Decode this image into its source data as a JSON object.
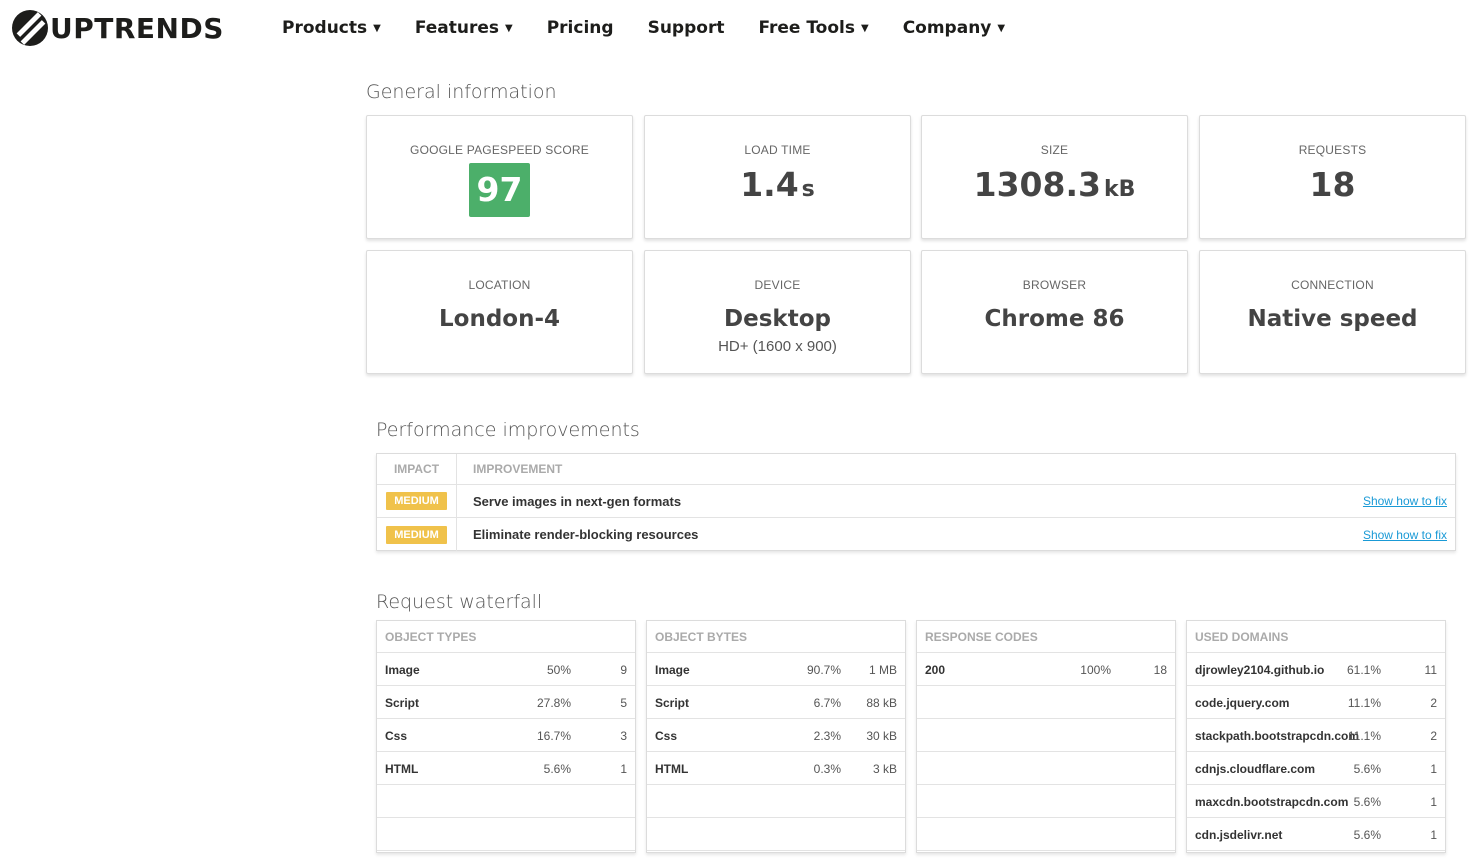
{
  "header": {
    "logo_text": "UPTRENDS",
    "nav": [
      {
        "label": "Products",
        "dropdown": true
      },
      {
        "label": "Features",
        "dropdown": true
      },
      {
        "label": "Pricing",
        "dropdown": false
      },
      {
        "label": "Support",
        "dropdown": false
      },
      {
        "label": "Free Tools",
        "dropdown": true
      },
      {
        "label": "Company",
        "dropdown": true
      }
    ]
  },
  "general": {
    "title": "General information",
    "score_label": "GOOGLE PAGESPEED SCORE",
    "score_value": "97",
    "score_color": "#4caf6a",
    "load_label": "LOAD TIME",
    "load_value": "1.4",
    "load_unit": "s",
    "size_label": "SIZE",
    "size_value": "1308.3",
    "size_unit": "kB",
    "requests_label": "REQUESTS",
    "requests_value": "18",
    "location_label": "LOCATION",
    "location_value": "London-4",
    "device_label": "DEVICE",
    "device_value": "Desktop",
    "device_sub": "HD+ (1600 x 900)",
    "browser_label": "BROWSER",
    "browser_value": "Chrome 86",
    "connection_label": "CONNECTION",
    "connection_value": "Native speed"
  },
  "performance": {
    "title": "Performance improvements",
    "col_impact": "IMPACT",
    "col_improvement": "IMPROVEMENT",
    "rows": [
      {
        "impact": "MEDIUM",
        "improvement": "Serve images in next-gen formats",
        "link": "Show how to fix"
      },
      {
        "impact": "MEDIUM",
        "improvement": "Eliminate render-blocking resources",
        "link": "Show how to fix"
      }
    ]
  },
  "waterfall": {
    "title": "Request waterfall",
    "object_types": {
      "header": "OBJECT TYPES",
      "rows": [
        {
          "name": "Image",
          "pct": "50%",
          "count": "9"
        },
        {
          "name": "Script",
          "pct": "27.8%",
          "count": "5"
        },
        {
          "name": "Css",
          "pct": "16.7%",
          "count": "3"
        },
        {
          "name": "HTML",
          "pct": "5.6%",
          "count": "1"
        }
      ]
    },
    "object_bytes": {
      "header": "OBJECT BYTES",
      "rows": [
        {
          "name": "Image",
          "pct": "90.7%",
          "count": "1 MB"
        },
        {
          "name": "Script",
          "pct": "6.7%",
          "count": "88 kB"
        },
        {
          "name": "Css",
          "pct": "2.3%",
          "count": "30 kB"
        },
        {
          "name": "HTML",
          "pct": "0.3%",
          "count": "3 kB"
        }
      ]
    },
    "response_codes": {
      "header": "RESPONSE CODES",
      "rows": [
        {
          "name": "200",
          "pct": "100%",
          "count": "18"
        }
      ]
    },
    "used_domains": {
      "header": "USED DOMAINS",
      "rows": [
        {
          "name": "djrowley2104.github.io",
          "pct": "61.1%",
          "count": "11"
        },
        {
          "name": "code.jquery.com",
          "pct": "11.1%",
          "count": "2"
        },
        {
          "name": "stackpath.bootstrapcdn.com",
          "pct": "11.1%",
          "count": "2"
        },
        {
          "name": "cdnjs.cloudflare.com",
          "pct": "5.6%",
          "count": "1"
        },
        {
          "name": "maxcdn.bootstrapcdn.com",
          "pct": "5.6%",
          "count": "1"
        },
        {
          "name": "cdn.jsdelivr.net",
          "pct": "5.6%",
          "count": "1"
        }
      ]
    }
  }
}
